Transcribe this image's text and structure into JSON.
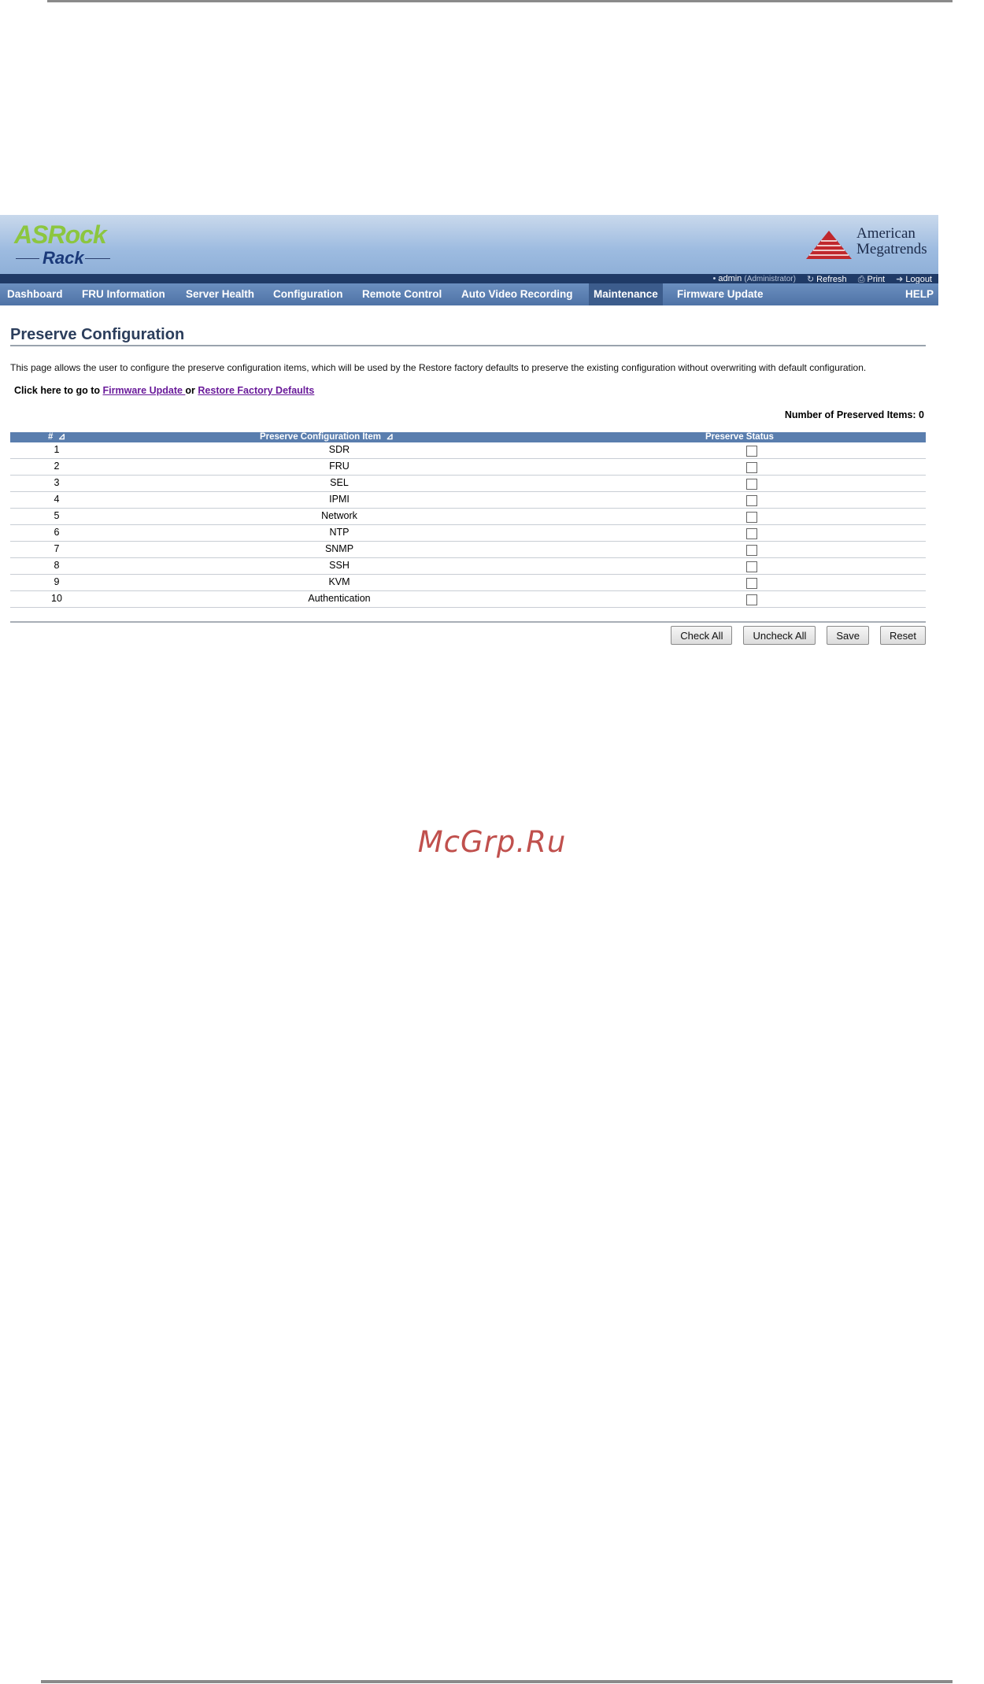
{
  "header": {
    "logo_top": "ASRock",
    "logo_bottom": "Rack",
    "vendor_line1": "American",
    "vendor_line2": "Megatrends"
  },
  "status": {
    "user": "admin",
    "role": "(Administrator)",
    "refresh": "Refresh",
    "print": "Print",
    "logout": "Logout"
  },
  "nav": {
    "items": [
      "Dashboard",
      "FRU Information",
      "Server Health",
      "Configuration",
      "Remote Control",
      "Auto Video Recording",
      "Maintenance",
      "Firmware Update"
    ],
    "active": "Maintenance",
    "help": "HELP"
  },
  "page": {
    "title": "Preserve Configuration",
    "description": "This page allows the user to configure the preserve configuration items, which will be used by the Restore factory defaults to preserve the existing configuration without overwriting with default configuration.",
    "goto_prefix": "Click here to go to",
    "link_firmware": "Firmware Update ",
    "goto_or": "or",
    "link_restore": "Restore Factory Defaults",
    "count_label": "Number of Preserved Items: 0"
  },
  "table": {
    "headers": [
      "#",
      "Preserve Configuration Item",
      "Preserve Status"
    ],
    "sort_glyph": "⊿",
    "rows": [
      {
        "num": "1",
        "item": "SDR"
      },
      {
        "num": "2",
        "item": "FRU"
      },
      {
        "num": "3",
        "item": "SEL"
      },
      {
        "num": "4",
        "item": "IPMI"
      },
      {
        "num": "5",
        "item": "Network"
      },
      {
        "num": "6",
        "item": "NTP"
      },
      {
        "num": "7",
        "item": "SNMP"
      },
      {
        "num": "8",
        "item": "SSH"
      },
      {
        "num": "9",
        "item": "KVM"
      },
      {
        "num": "10",
        "item": "Authentication"
      }
    ]
  },
  "buttons": {
    "check_all": "Check All",
    "uncheck_all": "Uncheck All",
    "save": "Save",
    "reset": "Reset"
  },
  "watermark": "McGrp.Ru",
  "colors": {
    "header_bg": "#9dbbe0",
    "nav_bg": "#5a7eae",
    "status_bg": "#1f3a66",
    "logo_green": "#8cc63f",
    "link": "#6a1b9a",
    "watermark": "#c0504d"
  }
}
